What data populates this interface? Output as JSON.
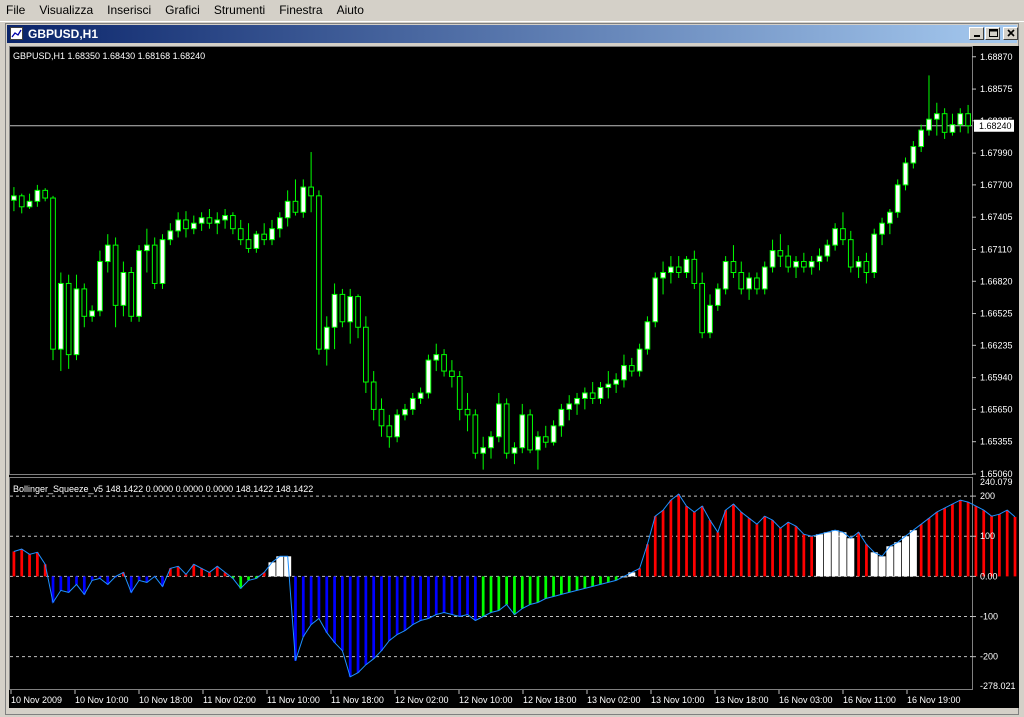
{
  "menu": [
    "File",
    "Visualizza",
    "Inserisci",
    "Grafici",
    "Strumenti",
    "Finestra",
    "Aiuto"
  ],
  "window": {
    "title": "GBPUSD,H1"
  },
  "main_panel": {
    "info": "GBPUSD,H1  1.68350 1.68430 1.68168 1.68240",
    "current_price_label": "1.68240",
    "y_ticks": [
      "1.68870",
      "1.68575",
      "1.68285",
      "1.67990",
      "1.67700",
      "1.67405",
      "1.67110",
      "1.66820",
      "1.66525",
      "1.66235",
      "1.65940",
      "1.65650",
      "1.65355",
      "1.65060"
    ]
  },
  "indicator_panel": {
    "info": "Bollinger_Squeeze_v5 148.1422 0.0000 0.0000 0.0000 148.1422 148.1422",
    "top_label": "240.079",
    "bottom_label": "-278.021",
    "y_ticks": [
      "200",
      "100",
      "0.00",
      "-100",
      "-200"
    ]
  },
  "x_labels": [
    "10 Nov 2009",
    "10 Nov 10:00",
    "10 Nov 18:00",
    "11 Nov 02:00",
    "11 Nov 10:00",
    "11 Nov 18:00",
    "12 Nov 02:00",
    "12 Nov 10:00",
    "12 Nov 18:00",
    "13 Nov 02:00",
    "13 Nov 10:00",
    "13 Nov 18:00",
    "16 Nov 03:00",
    "16 Nov 11:00",
    "16 Nov 19:00"
  ],
  "colors": {
    "background": "#000000",
    "candle_bull": "#ffffff",
    "candle_outline": "#00ff00",
    "histogram_red": "#ff0000",
    "histogram_blue": "#0000ff",
    "histogram_green": "#00ff00",
    "histogram_white": "#ffffff",
    "signal_line": "#1e90ff"
  },
  "chart_data": {
    "type": "candlestick",
    "symbol": "GBPUSD",
    "timeframe": "H1",
    "ylim": [
      1.6506,
      1.6895
    ],
    "current_price": 1.6824,
    "candles": [
      [
        1.6756,
        1.6768,
        1.6746,
        1.676
      ],
      [
        1.676,
        1.6762,
        1.6744,
        1.675
      ],
      [
        1.675,
        1.6762,
        1.6748,
        1.6755
      ],
      [
        1.6755,
        1.677,
        1.675,
        1.6765
      ],
      [
        1.6765,
        1.6767,
        1.6755,
        1.6758
      ],
      [
        1.6758,
        1.676,
        1.661,
        1.662
      ],
      [
        1.662,
        1.669,
        1.66,
        1.668
      ],
      [
        1.668,
        1.6688,
        1.6602,
        1.6615
      ],
      [
        1.6615,
        1.6688,
        1.661,
        1.6675
      ],
      [
        1.6675,
        1.668,
        1.664,
        1.665
      ],
      [
        1.665,
        1.666,
        1.6645,
        1.6655
      ],
      [
        1.6655,
        1.671,
        1.665,
        1.67
      ],
      [
        1.67,
        1.6725,
        1.669,
        1.6715
      ],
      [
        1.6715,
        1.6722,
        1.664,
        1.666
      ],
      [
        1.666,
        1.67,
        1.665,
        1.669
      ],
      [
        1.669,
        1.6695,
        1.6645,
        1.665
      ],
      [
        1.665,
        1.6715,
        1.6645,
        1.671
      ],
      [
        1.671,
        1.673,
        1.669,
        1.6715
      ],
      [
        1.6715,
        1.6722,
        1.6675,
        1.668
      ],
      [
        1.668,
        1.6725,
        1.6675,
        1.672
      ],
      [
        1.672,
        1.6735,
        1.6715,
        1.6728
      ],
      [
        1.6728,
        1.6745,
        1.6722,
        1.6738
      ],
      [
        1.6738,
        1.6746,
        1.6722,
        1.673
      ],
      [
        1.673,
        1.6742,
        1.6725,
        1.6735
      ],
      [
        1.6735,
        1.6745,
        1.6728,
        1.674
      ],
      [
        1.674,
        1.6748,
        1.673,
        1.6735
      ],
      [
        1.6735,
        1.6745,
        1.6725,
        1.6738
      ],
      [
        1.6738,
        1.6748,
        1.673,
        1.6742
      ],
      [
        1.6742,
        1.6745,
        1.6725,
        1.673
      ],
      [
        1.673,
        1.6738,
        1.6715,
        1.672
      ],
      [
        1.672,
        1.6735,
        1.6708,
        1.6712
      ],
      [
        1.6712,
        1.6728,
        1.6708,
        1.6725
      ],
      [
        1.6725,
        1.6735,
        1.6715,
        1.672
      ],
      [
        1.672,
        1.6738,
        1.6715,
        1.673
      ],
      [
        1.673,
        1.6745,
        1.6722,
        1.674
      ],
      [
        1.674,
        1.6765,
        1.6732,
        1.6755
      ],
      [
        1.6755,
        1.6775,
        1.6742,
        1.6745
      ],
      [
        1.6745,
        1.6775,
        1.674,
        1.6768
      ],
      [
        1.6768,
        1.68,
        1.6745,
        1.676
      ],
      [
        1.676,
        1.6765,
        1.6615,
        1.662
      ],
      [
        1.662,
        1.665,
        1.6605,
        1.664
      ],
      [
        1.664,
        1.668,
        1.662,
        1.667
      ],
      [
        1.667,
        1.6675,
        1.664,
        1.6645
      ],
      [
        1.6645,
        1.6675,
        1.6625,
        1.6668
      ],
      [
        1.6668,
        1.667,
        1.663,
        1.664
      ],
      [
        1.664,
        1.665,
        1.658,
        1.659
      ],
      [
        1.659,
        1.66,
        1.6555,
        1.6565
      ],
      [
        1.6565,
        1.6575,
        1.654,
        1.655
      ],
      [
        1.655,
        1.656,
        1.653,
        1.654
      ],
      [
        1.654,
        1.6565,
        1.6535,
        1.656
      ],
      [
        1.656,
        1.657,
        1.6555,
        1.6565
      ],
      [
        1.6565,
        1.658,
        1.656,
        1.6575
      ],
      [
        1.6575,
        1.6585,
        1.657,
        1.658
      ],
      [
        1.658,
        1.6615,
        1.6575,
        1.661
      ],
      [
        1.661,
        1.6625,
        1.66,
        1.6615
      ],
      [
        1.6615,
        1.662,
        1.6595,
        1.66
      ],
      [
        1.66,
        1.661,
        1.6585,
        1.6595
      ],
      [
        1.6595,
        1.66,
        1.6555,
        1.6565
      ],
      [
        1.6565,
        1.658,
        1.6545,
        1.656
      ],
      [
        1.656,
        1.6565,
        1.652,
        1.6525
      ],
      [
        1.6525,
        1.654,
        1.651,
        1.653
      ],
      [
        1.653,
        1.6545,
        1.652,
        1.654
      ],
      [
        1.654,
        1.658,
        1.6535,
        1.657
      ],
      [
        1.657,
        1.6575,
        1.652,
        1.6525
      ],
      [
        1.6525,
        1.6535,
        1.6515,
        1.653
      ],
      [
        1.653,
        1.657,
        1.6525,
        1.656
      ],
      [
        1.656,
        1.6565,
        1.6525,
        1.6528
      ],
      [
        1.6528,
        1.6545,
        1.651,
        1.654
      ],
      [
        1.654,
        1.655,
        1.653,
        1.6535
      ],
      [
        1.6535,
        1.6555,
        1.6532,
        1.655
      ],
      [
        1.655,
        1.657,
        1.654,
        1.6565
      ],
      [
        1.6565,
        1.6578,
        1.6555,
        1.657
      ],
      [
        1.657,
        1.658,
        1.656,
        1.6575
      ],
      [
        1.6575,
        1.6585,
        1.6565,
        1.658
      ],
      [
        1.658,
        1.659,
        1.657,
        1.6575
      ],
      [
        1.6575,
        1.659,
        1.657,
        1.6585
      ],
      [
        1.6585,
        1.66,
        1.6575,
        1.6588
      ],
      [
        1.6588,
        1.6598,
        1.658,
        1.6592
      ],
      [
        1.6592,
        1.6615,
        1.6585,
        1.6605
      ],
      [
        1.6605,
        1.6612,
        1.6595,
        1.66
      ],
      [
        1.66,
        1.6625,
        1.6595,
        1.662
      ],
      [
        1.662,
        1.665,
        1.6615,
        1.6645
      ],
      [
        1.6645,
        1.669,
        1.664,
        1.6685
      ],
      [
        1.6685,
        1.67,
        1.667,
        1.669
      ],
      [
        1.669,
        1.6705,
        1.668,
        1.6695
      ],
      [
        1.6695,
        1.6705,
        1.6685,
        1.669
      ],
      [
        1.669,
        1.6705,
        1.6685,
        1.6702
      ],
      [
        1.6702,
        1.671,
        1.6675,
        1.668
      ],
      [
        1.668,
        1.669,
        1.663,
        1.6635
      ],
      [
        1.6635,
        1.667,
        1.663,
        1.666
      ],
      [
        1.666,
        1.668,
        1.6655,
        1.6675
      ],
      [
        1.6675,
        1.6705,
        1.667,
        1.67
      ],
      [
        1.67,
        1.6715,
        1.6685,
        1.669
      ],
      [
        1.669,
        1.67,
        1.667,
        1.6675
      ],
      [
        1.6675,
        1.669,
        1.6665,
        1.6685
      ],
      [
        1.6685,
        1.669,
        1.667,
        1.6675
      ],
      [
        1.6675,
        1.67,
        1.667,
        1.6695
      ],
      [
        1.6695,
        1.672,
        1.669,
        1.671
      ],
      [
        1.671,
        1.6725,
        1.6695,
        1.6705
      ],
      [
        1.6705,
        1.6715,
        1.669,
        1.6695
      ],
      [
        1.6695,
        1.6705,
        1.6685,
        1.67
      ],
      [
        1.67,
        1.6708,
        1.669,
        1.6695
      ],
      [
        1.6695,
        1.6705,
        1.6688,
        1.67
      ],
      [
        1.67,
        1.6712,
        1.6692,
        1.6705
      ],
      [
        1.6705,
        1.672,
        1.67,
        1.6715
      ],
      [
        1.6715,
        1.6735,
        1.671,
        1.673
      ],
      [
        1.673,
        1.6745,
        1.6715,
        1.672
      ],
      [
        1.672,
        1.6728,
        1.669,
        1.6695
      ],
      [
        1.6695,
        1.6705,
        1.6685,
        1.67
      ],
      [
        1.67,
        1.6708,
        1.668,
        1.669
      ],
      [
        1.669,
        1.673,
        1.6685,
        1.6725
      ],
      [
        1.6725,
        1.674,
        1.6715,
        1.6735
      ],
      [
        1.6735,
        1.6748,
        1.6725,
        1.6745
      ],
      [
        1.6745,
        1.6775,
        1.674,
        1.677
      ],
      [
        1.677,
        1.6795,
        1.6765,
        1.679
      ],
      [
        1.679,
        1.681,
        1.6785,
        1.6805
      ],
      [
        1.6805,
        1.6825,
        1.68,
        1.682
      ],
      [
        1.682,
        1.687,
        1.6815,
        1.683
      ],
      [
        1.683,
        1.6845,
        1.6815,
        1.6835
      ],
      [
        1.6835,
        1.684,
        1.6812,
        1.6818
      ],
      [
        1.6818,
        1.6835,
        1.6815,
        1.6825
      ],
      [
        1.6825,
        1.684,
        1.6818,
        1.6835
      ],
      [
        1.6835,
        1.6843,
        1.6817,
        1.6824
      ]
    ],
    "indicator": {
      "name": "Bollinger_Squeeze_v5",
      "ylim": [
        -278.021,
        240.079
      ],
      "levels": [
        200,
        100,
        0,
        -100,
        -200
      ],
      "histogram": [
        [
          62,
          "red"
        ],
        [
          68,
          "red"
        ],
        [
          55,
          "red"
        ],
        [
          60,
          "red"
        ],
        [
          30,
          "red"
        ],
        [
          -65,
          "blue"
        ],
        [
          -35,
          "blue"
        ],
        [
          -40,
          "blue"
        ],
        [
          -20,
          "blue"
        ],
        [
          -45,
          "blue"
        ],
        [
          -10,
          "blue"
        ],
        [
          -5,
          "blue"
        ],
        [
          -20,
          "blue"
        ],
        [
          0,
          "blue"
        ],
        [
          10,
          "red"
        ],
        [
          -40,
          "blue"
        ],
        [
          -10,
          "blue"
        ],
        [
          -15,
          "blue"
        ],
        [
          0,
          "blue"
        ],
        [
          -25,
          "blue"
        ],
        [
          20,
          "red"
        ],
        [
          25,
          "red"
        ],
        [
          5,
          "red"
        ],
        [
          30,
          "red"
        ],
        [
          20,
          "red"
        ],
        [
          10,
          "red"
        ],
        [
          25,
          "red"
        ],
        [
          10,
          "red"
        ],
        [
          -5,
          "green"
        ],
        [
          -30,
          "green"
        ],
        [
          -10,
          "green"
        ],
        [
          -5,
          "green"
        ],
        [
          10,
          "red"
        ],
        [
          35,
          "white"
        ],
        [
          50,
          "white"
        ],
        [
          50,
          "white"
        ],
        [
          -210,
          "blue"
        ],
        [
          -150,
          "blue"
        ],
        [
          -120,
          "blue"
        ],
        [
          -105,
          "blue"
        ],
        [
          -140,
          "blue"
        ],
        [
          -165,
          "blue"
        ],
        [
          -185,
          "blue"
        ],
        [
          -250,
          "blue"
        ],
        [
          -240,
          "blue"
        ],
        [
          -220,
          "blue"
        ],
        [
          -205,
          "blue"
        ],
        [
          -185,
          "blue"
        ],
        [
          -160,
          "blue"
        ],
        [
          -145,
          "blue"
        ],
        [
          -135,
          "blue"
        ],
        [
          -120,
          "blue"
        ],
        [
          -110,
          "blue"
        ],
        [
          -105,
          "blue"
        ],
        [
          -95,
          "blue"
        ],
        [
          -90,
          "blue"
        ],
        [
          -95,
          "blue"
        ],
        [
          -100,
          "blue"
        ],
        [
          -95,
          "blue"
        ],
        [
          -110,
          "blue"
        ],
        [
          -100,
          "green"
        ],
        [
          -90,
          "green"
        ],
        [
          -85,
          "green"
        ],
        [
          -70,
          "green"
        ],
        [
          -95,
          "green"
        ],
        [
          -80,
          "green"
        ],
        [
          -70,
          "green"
        ],
        [
          -65,
          "green"
        ],
        [
          -55,
          "green"
        ],
        [
          -50,
          "green"
        ],
        [
          -45,
          "green"
        ],
        [
          -40,
          "green"
        ],
        [
          -35,
          "green"
        ],
        [
          -30,
          "green"
        ],
        [
          -25,
          "green"
        ],
        [
          -20,
          "green"
        ],
        [
          -15,
          "green"
        ],
        [
          -10,
          "green"
        ],
        [
          0,
          "white"
        ],
        [
          10,
          "white"
        ],
        [
          20,
          "red"
        ],
        [
          80,
          "red"
        ],
        [
          150,
          "red"
        ],
        [
          165,
          "red"
        ],
        [
          190,
          "red"
        ],
        [
          205,
          "red"
        ],
        [
          175,
          "red"
        ],
        [
          160,
          "red"
        ],
        [
          175,
          "red"
        ],
        [
          140,
          "red"
        ],
        [
          110,
          "red"
        ],
        [
          165,
          "red"
        ],
        [
          180,
          "red"
        ],
        [
          160,
          "red"
        ],
        [
          145,
          "red"
        ],
        [
          130,
          "red"
        ],
        [
          150,
          "red"
        ],
        [
          140,
          "red"
        ],
        [
          120,
          "red"
        ],
        [
          135,
          "red"
        ],
        [
          125,
          "red"
        ],
        [
          105,
          "red"
        ],
        [
          100,
          "red"
        ],
        [
          105,
          "white"
        ],
        [
          110,
          "white"
        ],
        [
          115,
          "white"
        ],
        [
          110,
          "white"
        ],
        [
          95,
          "white"
        ],
        [
          110,
          "red"
        ],
        [
          80,
          "red"
        ],
        [
          60,
          "white"
        ],
        [
          50,
          "white"
        ],
        [
          75,
          "white"
        ],
        [
          85,
          "white"
        ],
        [
          100,
          "white"
        ],
        [
          115,
          "white"
        ],
        [
          130,
          "red"
        ],
        [
          145,
          "red"
        ],
        [
          160,
          "red"
        ],
        [
          170,
          "red"
        ],
        [
          180,
          "red"
        ],
        [
          190,
          "red"
        ],
        [
          185,
          "red"
        ],
        [
          175,
          "red"
        ],
        [
          165,
          "red"
        ],
        [
          150,
          "red"
        ],
        [
          155,
          "red"
        ],
        [
          165,
          "red"
        ],
        [
          148.1422,
          "red"
        ]
      ]
    }
  }
}
